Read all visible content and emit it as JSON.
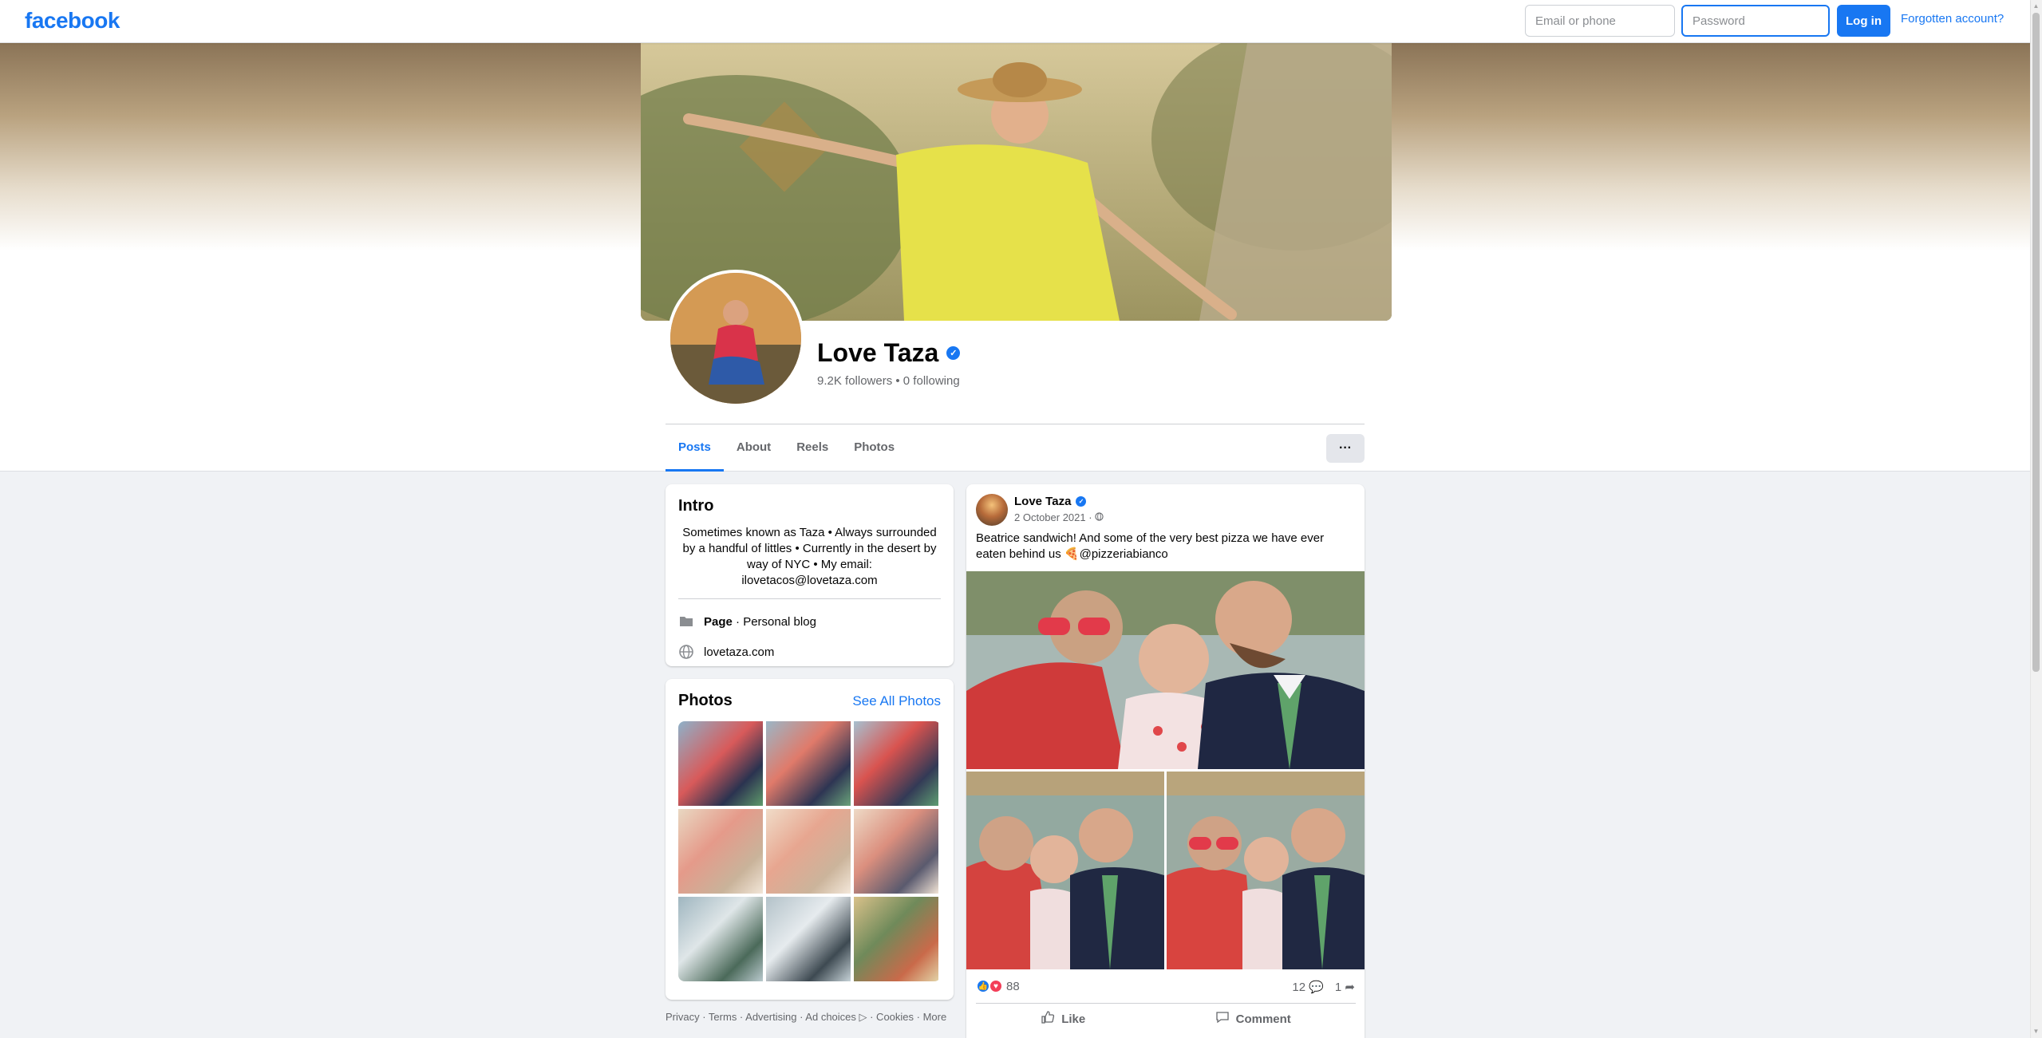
{
  "topbar": {
    "logo": "facebook",
    "email_placeholder": "Email or phone",
    "password_placeholder": "Password",
    "login_label": "Log in",
    "forgot_label": "Forgotten account?"
  },
  "profile": {
    "name": "Love Taza",
    "stats": "9.2K followers • 0 following",
    "tabs": [
      "Posts",
      "About",
      "Reels",
      "Photos"
    ],
    "active_tab": "Posts",
    "more_label": "···"
  },
  "intro": {
    "title": "Intro",
    "bio": "Sometimes known as Taza • Always surrounded by a handful of littles • Currently in the desert by way of NYC • My email: ilovetacos@lovetaza.com",
    "page_type_bold": "Page",
    "page_type_rest": " · Personal blog",
    "website": "lovetaza.com"
  },
  "photos": {
    "title": "Photos",
    "see_all": "See All Photos"
  },
  "footer": {
    "links": "Privacy · Terms · Advertising · Ad choices ▷ · Cookies · More"
  },
  "post": {
    "author": "Love Taza",
    "date": "2 October 2021 · ",
    "text": "Beatrice sandwich! And some of the very best pizza we have ever eaten behind us 🍕@pizzeriabianco",
    "reaction_count": "88",
    "comment_count": "12",
    "share_count": "1",
    "like_label": "Like",
    "comment_label": "Comment"
  },
  "colors": {
    "brand": "#1877f2",
    "page_bg": "#f0f2f5"
  }
}
